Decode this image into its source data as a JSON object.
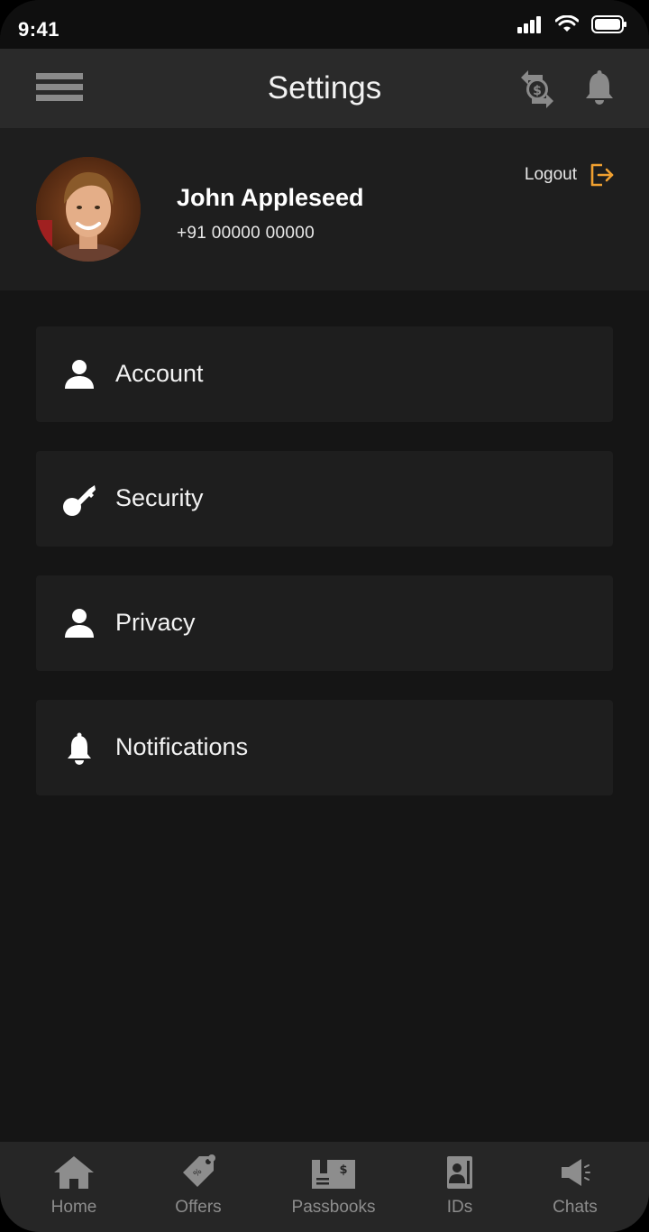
{
  "status_bar": {
    "time": "9:41"
  },
  "header": {
    "title": "Settings"
  },
  "profile": {
    "name": "John Appleseed",
    "phone": "+91 00000 00000",
    "logout_label": "Logout"
  },
  "settings": {
    "items": [
      {
        "label": "Account",
        "icon": "person-icon"
      },
      {
        "label": "Security",
        "icon": "key-icon"
      },
      {
        "label": "Privacy",
        "icon": "person-icon"
      },
      {
        "label": "Notifications",
        "icon": "bell-icon"
      }
    ]
  },
  "bottom_nav": {
    "items": [
      {
        "label": "Home",
        "icon": "home-icon"
      },
      {
        "label": "Offers",
        "icon": "tag-icon"
      },
      {
        "label": "Passbooks",
        "icon": "passbook-icon"
      },
      {
        "label": "IDs",
        "icon": "id-card-icon"
      },
      {
        "label": "Chats",
        "icon": "megaphone-icon"
      }
    ]
  },
  "colors": {
    "background": "#151515",
    "header": "#2a2a2a",
    "card": "#1e1e1e",
    "accent": "#f0a030",
    "nav_inactive": "#8d8d8d"
  }
}
